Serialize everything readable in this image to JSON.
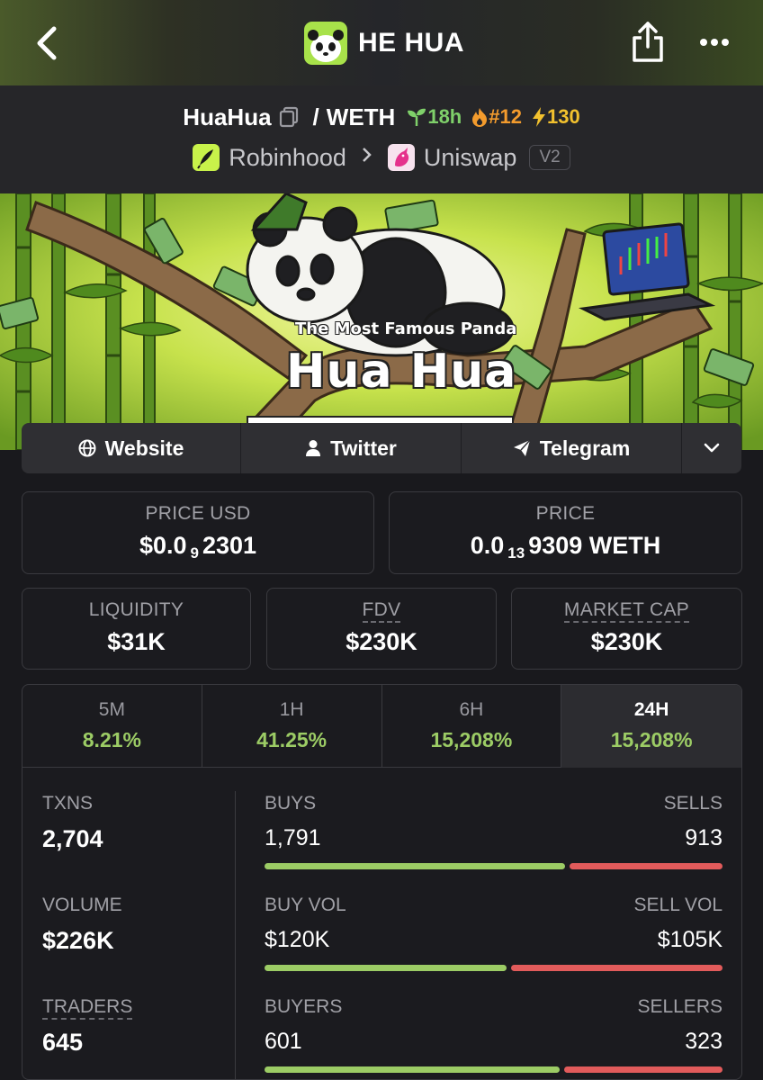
{
  "header": {
    "title": "HE HUA"
  },
  "pair": {
    "base": "HuaHua",
    "separator": "/",
    "quote": "WETH",
    "age": "18h",
    "rank": "#12",
    "boosts": "130",
    "chain": "Robinhood",
    "dex": "Uniswap",
    "version": "V2"
  },
  "banner": {
    "tagline": "The Most Famous Panda",
    "title": "Hua Hua"
  },
  "links": {
    "website": "Website",
    "twitter": "Twitter",
    "telegram": "Telegram"
  },
  "prices": {
    "usd_label": "PRICE USD",
    "usd_prefix": "$0.0",
    "usd_zeros": "9",
    "usd_digits": "2301",
    "native_label": "PRICE",
    "native_prefix": "0.0",
    "native_zeros": "13",
    "native_digits": "9309 WETH"
  },
  "metrics": {
    "liquidity_label": "LIQUIDITY",
    "liquidity": "$31K",
    "fdv_label": "FDV",
    "fdv": "$230K",
    "mcap_label": "MARKET CAP",
    "mcap": "$230K"
  },
  "timeframes": [
    {
      "label": "5M",
      "change": "8.21%"
    },
    {
      "label": "1H",
      "change": "41.25%"
    },
    {
      "label": "6H",
      "change": "15,208%"
    },
    {
      "label": "24H",
      "change": "15,208%"
    }
  ],
  "stats": {
    "txns_label": "TXNS",
    "txns": "2,704",
    "volume_label": "VOLUME",
    "volume": "$226K",
    "traders_label": "TRADERS",
    "traders": "645",
    "buys_label": "BUYS",
    "buys": "1,791",
    "sells_label": "SELLS",
    "sells": "913",
    "buy_share": 0.662,
    "buyvol_label": "BUY VOL",
    "buyvol": "$120K",
    "sellvol_label": "SELL VOL",
    "sellvol": "$105K",
    "buyvol_share": 0.533,
    "buyers_label": "BUYERS",
    "buyers": "601",
    "sellers_label": "SELLERS",
    "sellers": "323",
    "buyers_share": 0.65
  },
  "colors": {
    "positive": "#9ccc65",
    "negative": "#e25b5b",
    "brand": "#a8e24a"
  }
}
